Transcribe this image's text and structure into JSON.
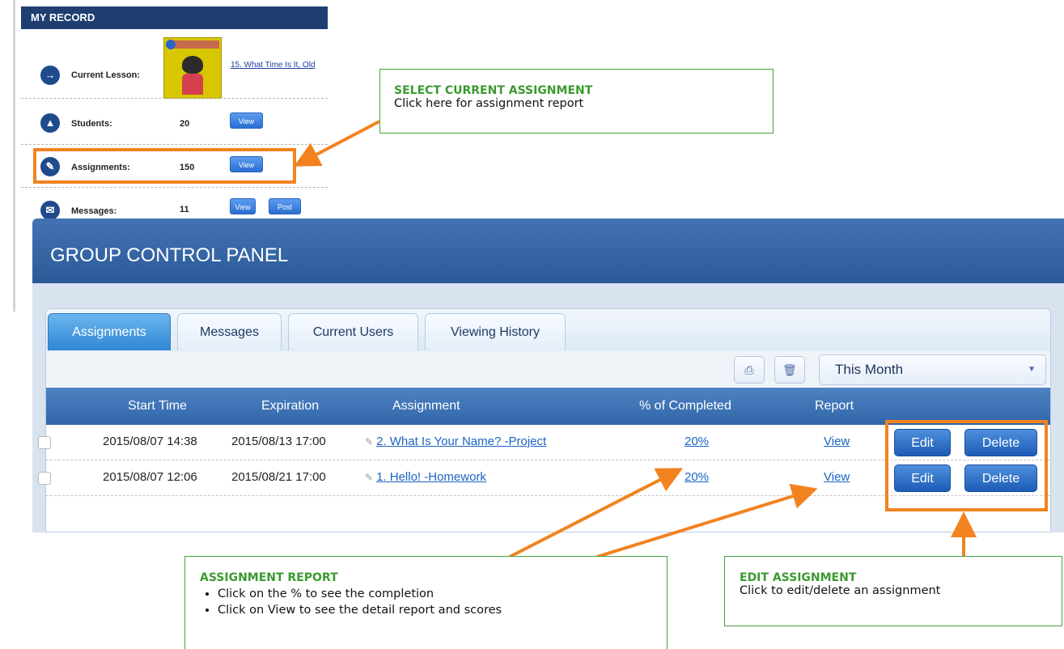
{
  "record": {
    "header": "MY RECORD",
    "current_lesson_label": "Current Lesson:",
    "current_lesson_link": "15. What Time Is It, Old",
    "students_label": "Students:",
    "students_count": "20",
    "assignments_label": "Assignments:",
    "assignments_count": "150",
    "messages_label": "Messages:",
    "messages_count": "11",
    "view_label": "View",
    "post_label": "Post"
  },
  "panel": {
    "title": "GROUP CONTROL PANEL",
    "tabs": [
      {
        "label": "Assignments",
        "active": true
      },
      {
        "label": "Messages",
        "active": false
      },
      {
        "label": "Current Users",
        "active": false
      },
      {
        "label": "Viewing History",
        "active": false
      }
    ],
    "period_select": "This Month",
    "columns": [
      "Start Time",
      "Expiration",
      "Assignment",
      "% of Completed",
      "Report"
    ],
    "rows": [
      {
        "start": "2015/08/07 14:38",
        "expiration": "2015/08/13 17:00",
        "assignment": "2. What Is Your Name? -Project",
        "completed": "20%",
        "report": "View",
        "edit": "Edit",
        "delete": "Delete"
      },
      {
        "start": "2015/08/07 12:06",
        "expiration": "2015/08/21 17:00",
        "assignment": "1. Hello! -Homework",
        "completed": "20%",
        "report": "View",
        "edit": "Edit",
        "delete": "Delete"
      }
    ]
  },
  "annotations": {
    "select_title": "SELECT CURRENT ASSIGNMENT",
    "select_text": "Click here for assignment report",
    "report_title": "ASSIGNMENT REPORT",
    "report_bullets": [
      "Click on the % to see the completion",
      "Click on View to see the detail report and scores"
    ],
    "edit_title": "EDIT ASSIGNMENT",
    "edit_text": "Click to edit/delete an assignment",
    "highlight_color": "#f28320",
    "callout_color": "#46a23e"
  }
}
